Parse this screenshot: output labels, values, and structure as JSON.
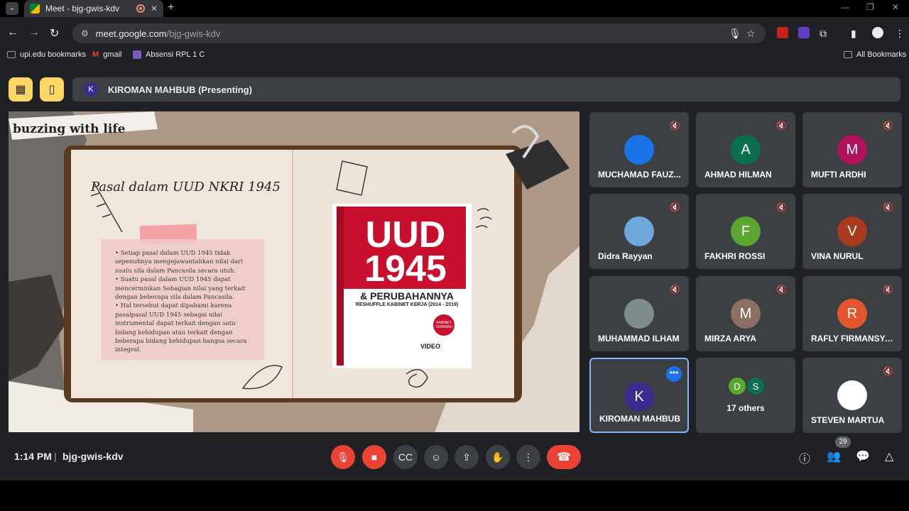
{
  "browser": {
    "tab_title": "Meet - bjg-gwis-kdv",
    "url_host": "meet.google.com",
    "url_path": "/bjg-gwis-kdv",
    "bookmarks": [
      "upi.edu bookmarks",
      "gmail",
      "Absensi RPL 1 C"
    ],
    "all_bookmarks": "All Bookmarks"
  },
  "meet": {
    "presenter_initial": "K",
    "presenter_label": "KIROMAN MAHBUB (Presenting)",
    "slide": {
      "header_strip": "buzzing with life",
      "title": "Pasal dalam UUD NKRI 1945",
      "bullets": [
        "• Setiap pasal dalam UUD 1945 tidak sepenuhnya mengejawantahkan nilai dari suatu sila dalam Pancasila secara utuh.",
        "• Suatu pasal dalam UUD 1945 dapat mencerminkan Sebagian nilai yang terkait dengan beberapa sila dalam Pancasila.",
        "• Hal tersebut dapat dipahami karena pasalpasal UUD 1945 sebagai nilai instrumental dapat terkait dengan satu bidang kehidupan atau terkait dengan beberapa bidang kehidupan bangsa secara integral."
      ],
      "book": {
        "title_line1": "UUD",
        "title_line2": "1945",
        "subtitle": "& PERUBAHANNYA",
        "subtitle2": "RESHUFFLE KABINET KERJA (2014 - 2019)",
        "badge": "KABINET TERBARU",
        "video": "VIDEO"
      }
    },
    "participants": [
      {
        "name": "MUCHAMAD FAUZ...",
        "initial": "",
        "color": "#1a73e8",
        "photo": true
      },
      {
        "name": "AHMAD HILMAN",
        "initial": "A",
        "color": "#0b6e4f"
      },
      {
        "name": "MUFTI ARDHI",
        "initial": "M",
        "color": "#b0125b"
      },
      {
        "name": "Didra Rayyan",
        "initial": "",
        "color": "#6fa8dc",
        "photo": true
      },
      {
        "name": "FAKHRI ROSSI",
        "initial": "F",
        "color": "#5aa631"
      },
      {
        "name": "VINA NURUL",
        "initial": "V",
        "color": "#a83a1f"
      },
      {
        "name": "MUHAMMAD ILHAM",
        "initial": "",
        "color": "#7f8c8d",
        "photo": true
      },
      {
        "name": "MIRZA ARYA",
        "initial": "M",
        "color": "#8d6e63"
      },
      {
        "name": "RAFLY FIRMANSYAH",
        "initial": "R",
        "color": "#e4572e"
      },
      {
        "name": "KIROMAN MAHBUB",
        "initial": "K",
        "color": "#3d2b8f"
      },
      {
        "name": "17 others",
        "initials": [
          "D",
          "S"
        ],
        "colors": [
          "#5aa631",
          "#0b6e4f"
        ]
      },
      {
        "name": "STEVEN MARTUA",
        "initial": "",
        "color": "#ffffff",
        "photo": true
      }
    ],
    "time": "1:14 PM",
    "meeting_code": "bjg-gwis-kdv",
    "participant_count": "29"
  }
}
